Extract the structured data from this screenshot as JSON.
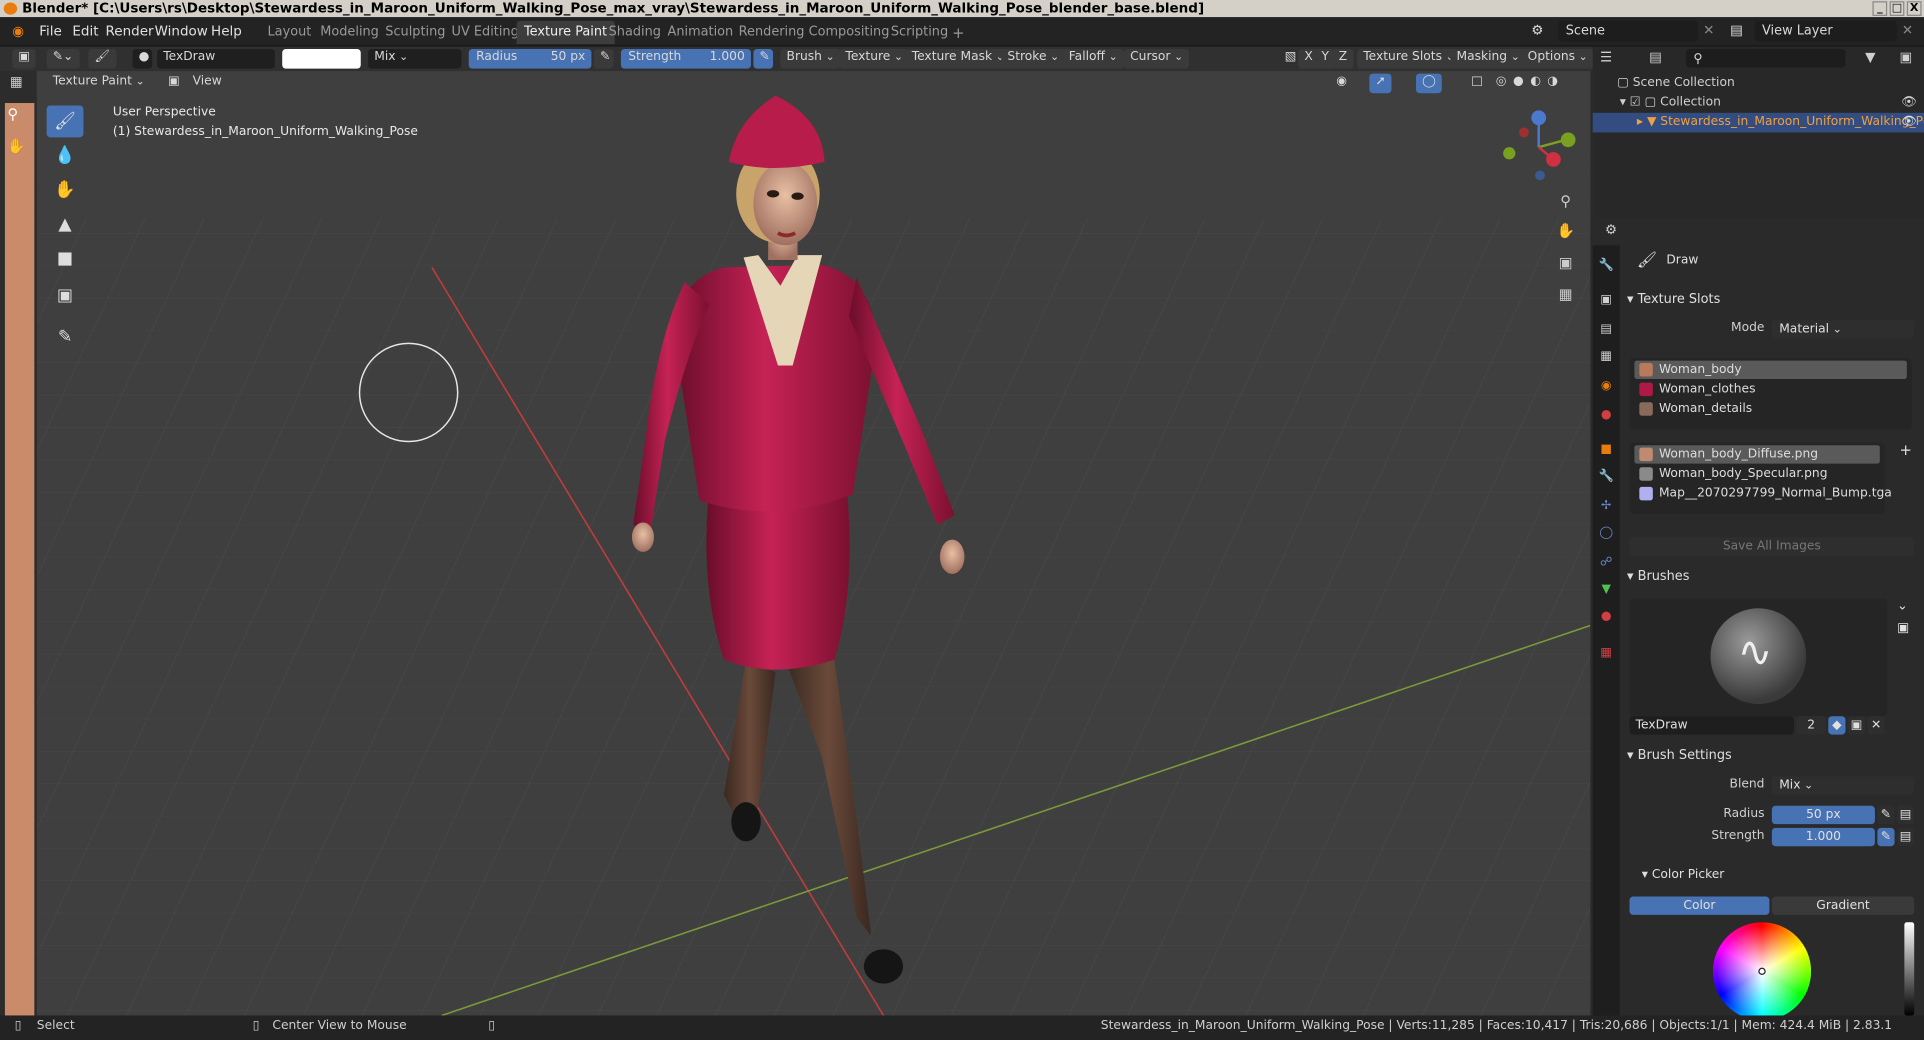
{
  "window": {
    "title": "Blender* [C:\\Users\\rs\\Desktop\\Stewardess_in_Maroon_Uniform_Walking_Pose_max_vray\\Stewardess_in_Maroon_Uniform_Walking_Pose_blender_base.blend]",
    "minimize": "_",
    "restore": "□",
    "close": "X"
  },
  "menu": [
    "File",
    "Edit",
    "Render",
    "Window",
    "Help"
  ],
  "workspaces": [
    "Layout",
    "Modeling",
    "Sculpting",
    "UV Editing",
    "Texture Paint",
    "Shading",
    "Animation",
    "Rendering",
    "Compositing",
    "Scripting"
  ],
  "active_workspace": "Texture Paint",
  "add_workspace": "+",
  "scene": {
    "label": "Scene",
    "view_layer": "View Layer"
  },
  "toolbar": {
    "brush_name": "TexDraw",
    "color_swatch": "#ffffff",
    "blend": "Mix",
    "radius_label": "Radius",
    "radius_value": "50 px",
    "strength_label": "Strength",
    "strength_value": "1.000",
    "menus": [
      "Brush",
      "Texture",
      "Texture Mask",
      "Stroke",
      "Falloff",
      "Cursor"
    ],
    "axes": [
      "X",
      "Y",
      "Z"
    ],
    "right_menus": [
      "Texture Slots",
      "Masking",
      "Options"
    ]
  },
  "header2": {
    "mode": "Texture Paint",
    "view": "View"
  },
  "viewport": {
    "perspective": "User Perspective",
    "object": "(1) Stewardess_in_Maroon_Uniform_Walking_Pose"
  },
  "outliner": {
    "scene_collection": "Scene Collection",
    "collection": "Collection",
    "object": "Stewardess_in_Maroon_Uniform_Walking_Pc"
  },
  "properties": {
    "tool_name": "Draw",
    "texture_slots": {
      "title": "Texture Slots",
      "mode_label": "Mode",
      "mode_value": "Material",
      "materials": [
        "Woman_body",
        "Woman_clothes",
        "Woman_details"
      ],
      "images": [
        "Woman_body_Diffuse.png",
        "Woman_body_Specular.png",
        "Map__2070297799_Normal_Bump.tga"
      ],
      "save_all": "Save All Images"
    },
    "brushes": {
      "title": "Brushes",
      "brush_name": "TexDraw",
      "users": "2"
    },
    "brush_settings": {
      "title": "Brush Settings",
      "blend_label": "Blend",
      "blend_value": "Mix",
      "radius_label": "Radius",
      "radius_value": "50 px",
      "strength_label": "Strength",
      "strength_value": "1.000"
    },
    "color_picker": {
      "title": "Color Picker",
      "color_tab": "Color",
      "gradient_tab": "Gradient"
    }
  },
  "status": {
    "select": "Select",
    "center": "Center View to Mouse",
    "info": "Stewardess_in_Maroon_Uniform_Walking_Pose | Verts:11,285 | Faces:10,417 | Tris:20,686 | Objects:1/1 | Mem: 424.4 MiB | 2.83.1"
  },
  "colors": {
    "accent": "#4772b3",
    "uniform": "#a01845",
    "selection": "#e87d0d"
  }
}
